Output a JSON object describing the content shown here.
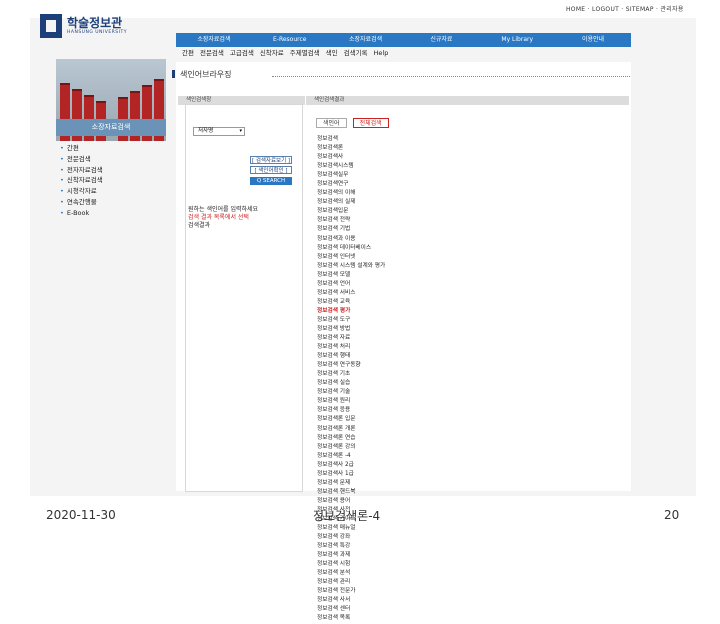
{
  "util_nav": "HOME · LOGOUT · SITEMAP · 관리자용",
  "logo": {
    "title": "학술정보관",
    "subtitle": "HANSUNG UNIVERSITY"
  },
  "top_nav": [
    "소장자료검색",
    "E-Resource",
    "소장자료검색",
    "신규자료",
    "My Library",
    "이용안내"
  ],
  "sub_nav": [
    "간편",
    "전문검색",
    "고급검색",
    "신착자료",
    "주제별검색",
    "색인",
    "검색기록",
    "Help"
  ],
  "sidebar": {
    "title": "소장자료검색",
    "items": [
      "간편",
      "전문검색",
      "전자자료검색",
      "신착자료검색",
      "시청각자료",
      "연속간행물",
      "E-Book"
    ]
  },
  "page_title": "색인어브라우징",
  "left_panel": {
    "header": "색인검색창",
    "select_value": "저자명",
    "buttons": [
      "[ 검색자료보기 ]",
      "[ 색인어확인 ]",
      "Q SEARCH"
    ],
    "note_lines": [
      "원하는 색인어를 입력하세요",
      "검색 결과 목록에서 선택",
      "검색결과"
    ]
  },
  "right_panel": {
    "header": "색인검색결과",
    "tabs": [
      "색인어",
      "전체검색"
    ],
    "list": [
      "정보검색",
      "정보검색론",
      "정보검색사",
      "정보검색시스템",
      "정보검색실무",
      "정보검색연구",
      "정보검색의 이해",
      "정보검색의 실제",
      "정보검색입문",
      "정보검색 전략",
      "정보검색 기법",
      "정보검색과 이용",
      "정보검색 데이터베이스",
      "정보검색 인터넷",
      "정보검색 시스템 설계와 평가",
      "정보검색 모델",
      "정보검색 언어",
      "정보검색 서비스",
      "정보검색 교육",
      "정보검색 평가",
      "정보검색 도구",
      "정보검색 방법",
      "정보검색 자료",
      "정보검색 처리",
      "정보검색 행태",
      "정보검색 연구동향",
      "정보검색 기초",
      "정보검색 실습",
      "정보검색 기술",
      "정보검색 원리",
      "정보검색 응용",
      "정보검색론 입문",
      "정보검색론 개론",
      "정보검색론 연습",
      "정보검색론 강의",
      "정보검색론 -4",
      "정보검색사 2급",
      "정보검색사 1급",
      "정보검색 문제",
      "정보검색 핸드북",
      "정보검색 용어",
      "정보검색 사전",
      "정보검색 가이드",
      "정보검색 매뉴얼",
      "정보검색 강좌",
      "정보검색 특강",
      "정보검색 과제",
      "정보검색 시험",
      "정보검색 분석",
      "정보검색 관리",
      "정보검색 전문가",
      "정보검색 사서",
      "정보검색 센터",
      "정보검색 목록"
    ],
    "highlight_index": 19
  },
  "footer": {
    "date": "2020-11-30",
    "title": "정보검색론-4",
    "page": "20"
  }
}
